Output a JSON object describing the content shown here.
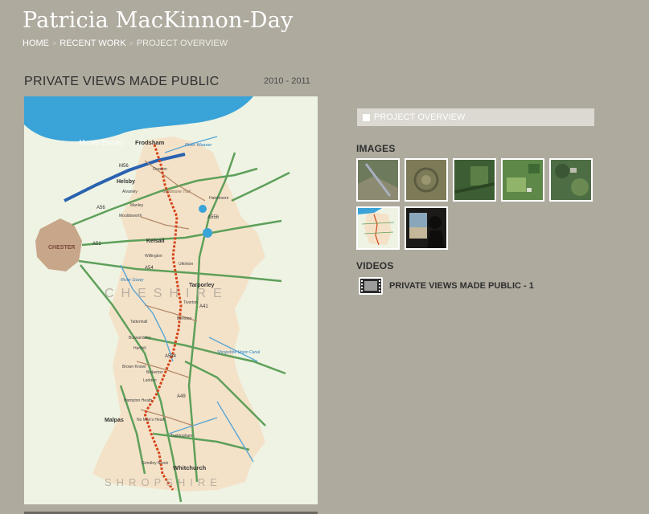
{
  "site": {
    "title": "Patricia MacKinnon-Day"
  },
  "breadcrumb": {
    "home": "HOME",
    "recent_work": "RECENT WORK",
    "current": "PROJECT OVERVIEW",
    "separator": ">"
  },
  "project": {
    "title": "PRIVATE VIEWS MADE PUBLIC",
    "years": "2010 - 2011"
  },
  "map": {
    "labels": {
      "estuary": "Mersey Estuary",
      "chester": "CHESTER",
      "cheshire": "CHESHIRE",
      "shropshire": "SHROPSHIRE",
      "frodsham": "Frodsham",
      "helsby": "Helsby",
      "kelsall": "Kelsall",
      "tarporley": "Tarporley",
      "malpas": "Malpas",
      "whitchurch": "Whitchurch",
      "weaver": "River Weaver",
      "gowy": "River Gowy",
      "canal": "Shropshire Union Canal",
      "m56": "M56",
      "a56": "A56",
      "a51": "A51",
      "a54": "A54",
      "a49": "A49",
      "a534": "A534",
      "a41": "A41",
      "a556": "A556",
      "overton": "Overton",
      "alvanley": "Alvanley",
      "manley": "Manley",
      "mouldsworth": "Mouldsworth",
      "hatchmere": "Hatchmere",
      "willington": "Willington",
      "utkinton": "Utkinton",
      "tiverton": "Tiverton",
      "beeston": "Beeston",
      "tattenhall": "Tattenhall",
      "burwardsley": "Burwardsley",
      "harthill": "Harthill",
      "brown_knowl": "Brown Knowl",
      "bickerton": "Bickerton",
      "larkton": "Larkton",
      "hampton_heath": "Hampton Heath",
      "no_mans_heath": "No Man's Heath",
      "tushingham": "Tushingham",
      "grindley_brook": "Grindley Brook",
      "trail_text": "Sandstone Trail"
    }
  },
  "sidebar": {
    "overview_label": "PROJECT OVERVIEW",
    "images_heading": "IMAGES",
    "videos_heading": "VIDEOS",
    "video_label": "PRIVATE VIEWS MADE PUBLIC - 1"
  },
  "colors": {
    "background": "#aeaa9e",
    "water": "#3aa3d8",
    "land": "#f4e2c8",
    "road_green": "#5ea05a",
    "trail": "#d4451a",
    "motorway": "#2a62b0"
  }
}
